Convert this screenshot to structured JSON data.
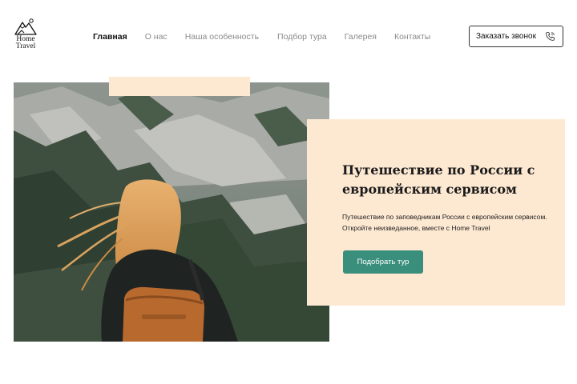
{
  "brand": {
    "line1": "Home",
    "line2": "Travel"
  },
  "nav": [
    {
      "label": "Главная",
      "active": true
    },
    {
      "label": "О нас",
      "active": false
    },
    {
      "label": "Наша особенность",
      "active": false
    },
    {
      "label": "Подбор тура",
      "active": false
    },
    {
      "label": "Галерея",
      "active": false
    },
    {
      "label": "Контакты",
      "active": false
    }
  ],
  "header": {
    "call_button": {
      "label": "Заказать звонок",
      "icon": "phone-icon"
    }
  },
  "hero": {
    "title": "Путешествие по России с европейским сервисом",
    "description": "Путешествие по заповедникам России с европейским сервисом. Откройте неизведанное, вместе с Home Travel",
    "cta_label": "Подобрать тур",
    "photo_subject": "hero-photo"
  },
  "colors": {
    "accent_peach": "#fde9d2",
    "cta_green": "#3a8f7c",
    "nav_muted": "#8a8a8a",
    "text_dark": "#111111"
  }
}
